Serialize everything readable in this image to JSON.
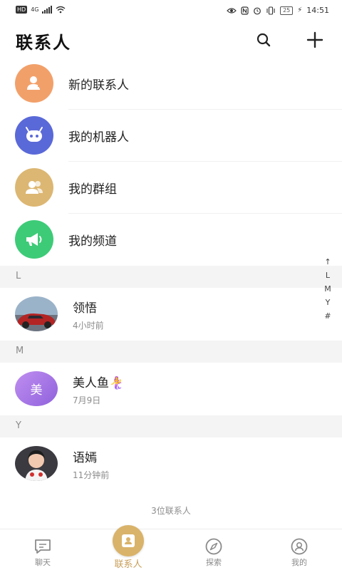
{
  "statusbar": {
    "network_left": "HD",
    "network_type": "4G",
    "battery": "25",
    "time": "14:51"
  },
  "header": {
    "title": "联系人"
  },
  "menu": [
    {
      "label": "新的联系人",
      "icon": "new-contact-icon",
      "color": "#f2a06a"
    },
    {
      "label": "我的机器人",
      "icon": "robot-icon",
      "color": "#5a69d8"
    },
    {
      "label": "我的群组",
      "icon": "group-icon",
      "color": "#dcb773"
    },
    {
      "label": "我的频道",
      "icon": "channel-icon",
      "color": "#3ecb78"
    }
  ],
  "sections": [
    {
      "letter": "L",
      "contacts": [
        {
          "name": "领悟",
          "time": "4小时前",
          "avatar_type": "photo"
        }
      ]
    },
    {
      "letter": "M",
      "contacts": [
        {
          "name": "美人鱼🧜‍♀️",
          "time": "7月9日",
          "avatar_type": "text",
          "avatar_text": "美",
          "avatar_color": "#a97ee8"
        }
      ]
    },
    {
      "letter": "Y",
      "contacts": [
        {
          "name": "语嫣",
          "time": "11分钟前",
          "avatar_type": "photo"
        }
      ]
    }
  ],
  "index_bar": [
    "↑",
    "L",
    "M",
    "Y",
    "#"
  ],
  "footer": {
    "count_text": "3位联系人"
  },
  "tabs": [
    {
      "label": "聊天",
      "icon": "chat-icon",
      "active": false
    },
    {
      "label": "联系人",
      "icon": "contacts-icon",
      "active": true
    },
    {
      "label": "探索",
      "icon": "compass-icon",
      "active": false
    },
    {
      "label": "我的",
      "icon": "profile-icon",
      "active": false
    }
  ],
  "colors": {
    "accent": "#d9b36a",
    "section_bg": "#f4f4f4",
    "muted_text": "#8c8c8c"
  }
}
